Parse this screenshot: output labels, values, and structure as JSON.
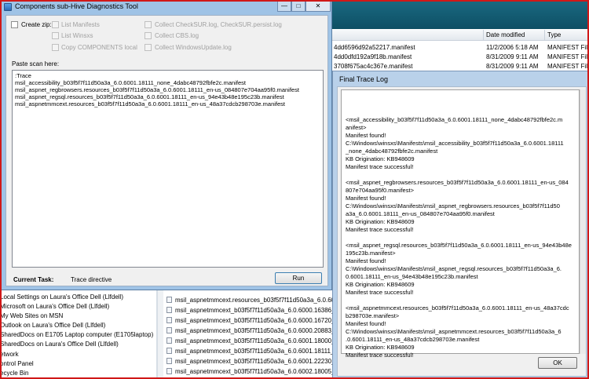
{
  "explorer": {
    "columns": [
      "Date modified",
      "Type"
    ],
    "files": [
      {
        "name": "4dd6596d92a52217.manifest",
        "date": "11/2/2006 5:18 AM",
        "type": "MANIFEST File"
      },
      {
        "name": "4dd0dfd192a9f18b.manifest",
        "date": "8/31/2009 9:11 AM",
        "type": "MANIFEST File"
      },
      {
        "name": "3708f675ac4c367e.manifest",
        "date": "8/31/2009 9:11 AM",
        "type": "MANIFEST File"
      }
    ],
    "nav_items": [
      "Local Settings on Laura's Office Dell (Llfdell)",
      "Microsoft on Laura's Office Dell (Llfdell)",
      "My Web Sites on MSN",
      "Outlook on Laura's Office Dell (Llfdell)",
      "SharedDocs on E1705 Laptop computer (E1705laptop)",
      "SharedDocs on Laura's Office Dell (Llfdell)",
      "etwork",
      "ontrol Panel",
      "ecycle Bin"
    ],
    "lower_files": [
      "msil_aspnetmmcext.resources_b03f5f7f11d50a3a_6.0.6001",
      "msil_aspnetmmcext_b03f5f7f11d50a3a_6.0.6000.16386_non",
      "msil_aspnetmmcext_b03f5f7f11d50a3a_6.0.6000.16720_non",
      "msil_aspnetmmcext_b03f5f7f11d50a3a_6.0.6000.20883_non",
      "msil_aspnetmmcext_b03f5f7f11d50a3a_6.0.6001.18000_non",
      "msil_aspnetmmcext_b03f5f7f11d50a3a_6.0.6001.18111_non",
      "msil_aspnetmmcext_b03f5f7f11d50a3a_6.0.6001.22230_non",
      "msil_aspnetmmcext_b03f5f7f11d50a3a_6.0.6002.18005_non"
    ]
  },
  "tool": {
    "title": "Components sub-Hive Diagnostics Tool",
    "options": {
      "create_zip": "Create zip:",
      "list_manifests": "List Manifests",
      "list_winsxs": "List Winsxs",
      "copy_components": "Copy COMPONENTS local",
      "collect_checksur": "Collect CheckSUR.log, CheckSUR.persist.log",
      "collect_cbs": "Collect CBS.log",
      "collect_windowsupdate": "Collect WindowsUpdate.log"
    },
    "paste_label": "Paste scan here:",
    "scan_lines": [
      ":Trace",
      "msil_accessibility_b03f5f7f11d50a3a_6.0.6001.18111_none_4dabc48792fbfe2c.manifest",
      "msil_aspnet_regbrowsers.resources_b03f5f7f11d50a3a_6.0.6001.18111_en-us_084807e704aa95f0.manifest",
      "msil_aspnet_regsql.resources_b03f5f7f11d50a3a_6.0.6001.18111_en-us_94e43b48e195c23b.manifest",
      "msil_aspnetmmcext.resources_b03f5f7f11d50a3a_6.0.6001.18111_en-us_48a37cdcb298703e.manifest"
    ],
    "current_task_label": "Current Task:",
    "current_task_value": "Trace directive",
    "run_label": "Run"
  },
  "trace": {
    "title": "Final Trace Log",
    "lines": [
      "<msil_accessibility_b03f5f7f11d50a3a_6.0.6001.18111_none_4dabc48792fbfe2c.m",
      "anifest>",
      "Manifest found!",
      "C:\\Windows\\winsxs\\Manifests\\msil_accessibility_b03f5f7f11d50a3a_6.0.6001.18111",
      "_none_4dabc48792fbfe2c.manifest",
      "KB Origination: KB948609",
      "Manifest trace successful!",
      "",
      "<msil_aspnet_regbrowsers.resources_b03f5f7f11d50a3a_6.0.6001.18111_en-us_084",
      "807e704aa95f0.manifest>",
      "Manifest found!",
      "C:\\Windows\\winsxs\\Manifests\\msil_aspnet_regbrowsers.resources_b03f5f7f11d50",
      "a3a_6.0.6001.18111_en-us_084807e704aa95f0.manifest",
      "KB Origination: KB948609",
      "Manifest trace successful!",
      "",
      "<msil_aspnet_regsql.resources_b03f5f7f11d50a3a_6.0.6001.18111_en-us_94e43b48e",
      "195c23b.manifest>",
      "Manifest found!",
      "C:\\Windows\\winsxs\\Manifests\\msil_aspnet_regsql.resources_b03f5f7f11d50a3a_6.",
      "0.6001.18111_en-us_94e43b48e195c23b.manifest",
      "KB Origination: KB948609",
      "Manifest trace successful!",
      "",
      "<msil_aspnetmmcext.resources_b03f5f7f11d50a3a_6.0.6001.18111_en-us_48a37cdc",
      "b298703e.manifest>",
      "Manifest found!",
      "C:\\Windows\\winsxs\\Manifests\\msil_aspnetmmcext.resources_b03f5f7f11d50a3a_6",
      ".0.6001.18111_en-us_48a37cdcb298703e.manifest",
      "KB Origination: KB948609",
      "Manifest trace successful!"
    ],
    "ok_label": "OK"
  },
  "colors": {
    "accent_teal": "#1a6a82",
    "frame_red": "#d01818",
    "window_blue": "#9fc3e6"
  }
}
